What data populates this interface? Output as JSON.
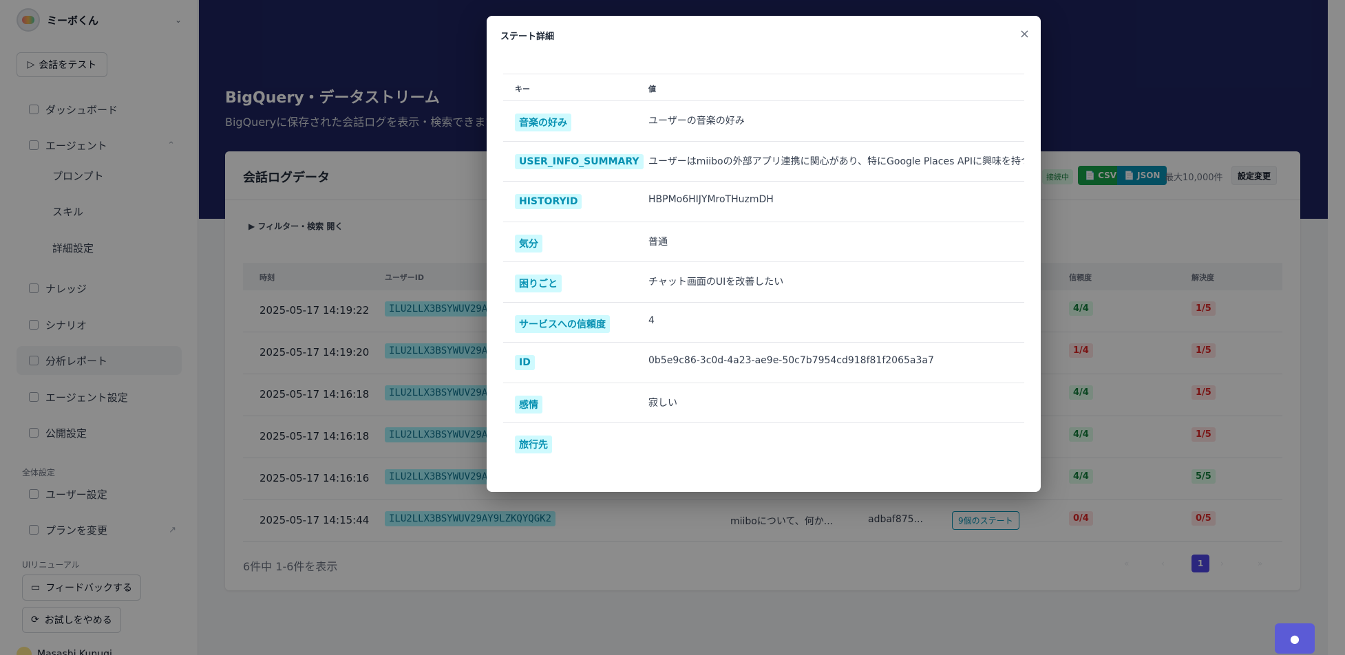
{
  "sidebar": {
    "agent_name": "ミーボくん",
    "test_button": "会話をテスト",
    "nav": {
      "dashboard": "ダッシュボード",
      "agent": "エージェント",
      "prompt": "プロンプト",
      "skill": "スキル",
      "detail": "詳細設定",
      "knowledge": "ナレッジ",
      "scenario": "シナリオ",
      "report": "分析レポート",
      "agent_settings": "エージェント設定",
      "publish": "公開設定"
    },
    "global_label": "全体設定",
    "user_settings": "ユーザー設定",
    "plan_change": "プランを変更",
    "renewal_label": "UIリニューアル",
    "feedback_button": "フィードバックする",
    "quit_trial_button": "お試しをやめる",
    "user_name": "Masashi Kunugi"
  },
  "main": {
    "title": "BigQuery・データストリーム",
    "subtitle": "BigQueryに保存された会話ログを表示・検索できます",
    "card_title": "会話ログデータ",
    "status": "接続中",
    "csv": "📄 CSV",
    "json": "📄 JSON",
    "max": "最大10,000件",
    "settings_button": "設定変更",
    "filter_link": "▶ フィルター・検索 開く",
    "columns": {
      "time": "時刻",
      "user_id": "ユーザーID",
      "trust": "信頼度",
      "resolution": "解決度"
    },
    "rows": [
      {
        "time": "2025-05-17 14:19:22",
        "uid": "ILU2LLX3BSYWUV29A",
        "trust": "4/4",
        "resolution": "1/5"
      },
      {
        "time": "2025-05-17 14:19:20",
        "uid": "ILU2LLX3BSYWUV29A",
        "trust": "1/4",
        "resolution": "1/5"
      },
      {
        "time": "2025-05-17 14:16:18",
        "uid": "ILU2LLX3BSYWUV29A",
        "trust": "4/4",
        "resolution": "1/5"
      },
      {
        "time": "2025-05-17 14:16:18",
        "uid": "ILU2LLX3BSYWUV29A",
        "trust": "4/4",
        "resolution": "1/5"
      },
      {
        "time": "2025-05-17 14:16:16",
        "uid": "ILU2LLX3BSYWUV29A",
        "trust": "4/4",
        "resolution": "5/5"
      },
      {
        "time": "2025-05-17 14:15:44",
        "uid": "ILU2LLX3BSYWUV29AY9LZKQYQGK2",
        "message": "miiboについて、何か...",
        "history": "adbaf875...",
        "states": "9個のステート",
        "trust": "0/4",
        "resolution": "0/5"
      }
    ],
    "footer_count": "6件中 1-6件を表示",
    "page": "1"
  },
  "modal": {
    "title": "ステート詳細",
    "close": "×",
    "key_header": "キー",
    "value_header": "値",
    "rows": [
      {
        "key": "音楽の好み",
        "value": "ユーザーの音楽の好み"
      },
      {
        "key": "USER_INFO_SUMMARY",
        "value": "ユーザーはmiiboの外部アプリ連携に関心があり、特にGoogle Places APIに興味を持つ"
      },
      {
        "key": "HISTORYID",
        "value": "HBPMo6HIJYMroTHuzmDH"
      },
      {
        "key": "気分",
        "value": "普通"
      },
      {
        "key": "困りごと",
        "value": "チャット画面のUIを改善したい"
      },
      {
        "key": "サービスへの信頼度",
        "value": "4"
      },
      {
        "key": "ID",
        "value": "0b5e9c86-3c0d-4a23-ae9e-50c7b7954cd918f81f2065a3a7"
      },
      {
        "key": "感情",
        "value": "寂しい"
      },
      {
        "key": "旅行先",
        "value": ""
      }
    ]
  }
}
